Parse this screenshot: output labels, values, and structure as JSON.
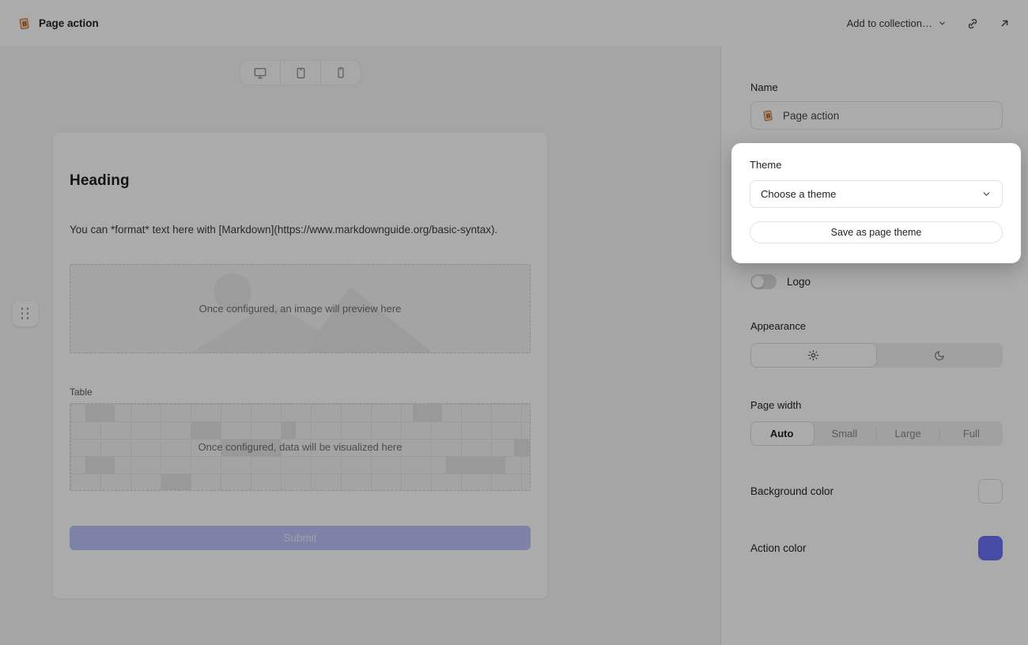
{
  "topbar": {
    "title": "Page action",
    "add_to_collection_label": "Add to collection…",
    "icons": [
      "page-logo-icon",
      "chevron-down-icon",
      "link-icon",
      "arrow-up-right-icon"
    ]
  },
  "canvas": {
    "device_toggle": {
      "options": [
        "desktop",
        "tablet",
        "phone"
      ],
      "selected": "desktop"
    },
    "card": {
      "heading": "Heading",
      "markdown_text": "You can *format* text here with [Markdown](https://www.markdownguide.org/basic-syntax).",
      "image_placeholder_text": "Once configured, an image will preview here",
      "table_label": "Table",
      "table_placeholder_text": "Once configured, data will be visualized here",
      "submit_label": "Submit"
    }
  },
  "sidebar": {
    "name": {
      "label": "Name",
      "value": "Page action",
      "icon": "page-logo-icon"
    },
    "logo": {
      "label": "Logo",
      "enabled": false
    },
    "appearance": {
      "label": "Appearance",
      "options": [
        "light",
        "dark"
      ],
      "selected": "light"
    },
    "page_width": {
      "label": "Page width",
      "options": [
        "Auto",
        "Small",
        "Large",
        "Full"
      ],
      "selected": "Auto"
    },
    "background_color": {
      "label": "Background color",
      "value": "#ffffff"
    },
    "action_color": {
      "label": "Action color",
      "value": "#6a71f5"
    }
  },
  "theme_popover": {
    "label": "Theme",
    "select_value": "Choose a theme",
    "save_button_label": "Save as page theme"
  }
}
